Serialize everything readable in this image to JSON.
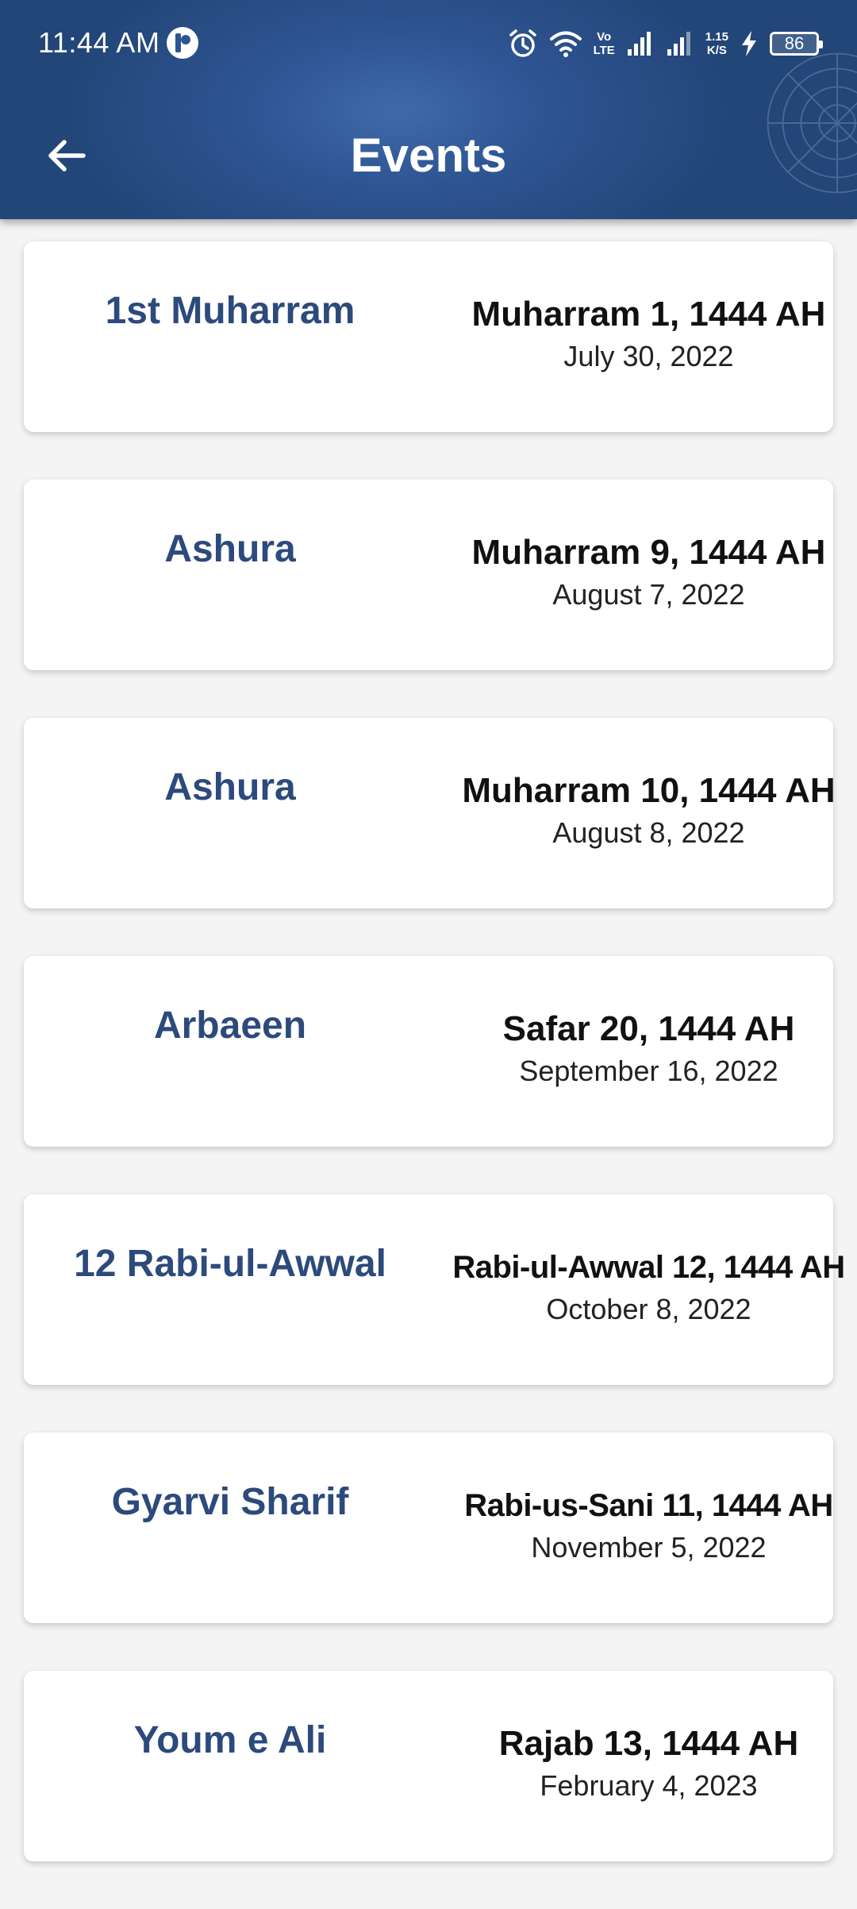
{
  "status_bar": {
    "time": "11:44 AM",
    "network_top": "Vo",
    "network_bottom": "LTE",
    "speed_value": "1.15",
    "speed_unit": "K/S",
    "battery_level": "86"
  },
  "header": {
    "title": "Events"
  },
  "events": [
    {
      "name": "1st Muharram",
      "hijri": "Muharram 1, 1444 AH",
      "gregorian": "July 30, 2022"
    },
    {
      "name": "Ashura",
      "hijri": "Muharram 9, 1444 AH",
      "gregorian": "August 7, 2022"
    },
    {
      "name": "Ashura",
      "hijri": "Muharram 10, 1444 AH",
      "gregorian": "August 8, 2022"
    },
    {
      "name": "Arbaeen",
      "hijri": "Safar 20, 1444 AH",
      "gregorian": "September 16, 2022"
    },
    {
      "name": "12 Rabi-ul-Awwal",
      "hijri": "Rabi-ul-Awwal 12, 1444 AH",
      "gregorian": "October 8, 2022"
    },
    {
      "name": "Gyarvi Sharif",
      "hijri": "Rabi-us-Sani 11, 1444 AH",
      "gregorian": "November 5, 2022"
    },
    {
      "name": "Youm e Ali",
      "hijri": "Rajab 13, 1444 AH",
      "gregorian": "February 4, 2023"
    }
  ],
  "colors": {
    "header_bg": "#2e5492",
    "event_name": "#2c4a7c",
    "page_bg": "#f4f4f4"
  },
  "icons": [
    "app-notification-icon",
    "alarm-icon",
    "wifi-icon",
    "signal-icon",
    "charging-icon",
    "battery-icon",
    "back-arrow-icon"
  ]
}
